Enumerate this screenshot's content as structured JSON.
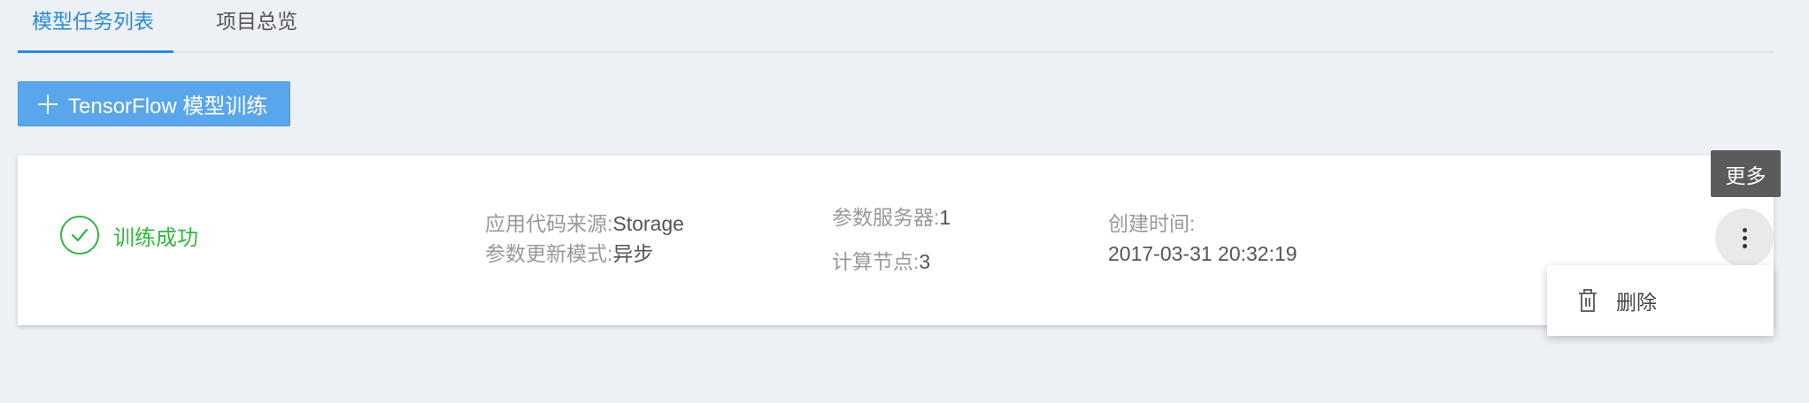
{
  "tabs": [
    {
      "label": "模型任务列表",
      "active": true
    },
    {
      "label": "项目总览",
      "active": false
    }
  ],
  "create_button": {
    "label": "TensorFlow 模型训练",
    "icon": "plus-icon"
  },
  "task": {
    "status": {
      "text": "训练成功",
      "icon": "check-circle-icon",
      "color": "#2db83d"
    },
    "code_source": {
      "label": "应用代码来源:",
      "value": "Storage"
    },
    "update_mode": {
      "label": "参数更新模式:",
      "value": "异步"
    },
    "param_servers": {
      "label": "参数服务器:",
      "value": "1"
    },
    "compute_nodes": {
      "label": "计算节点:",
      "value": "3"
    },
    "created": {
      "label": "创建时间:",
      "value": "2017-03-31 20:32:19"
    }
  },
  "more": {
    "tooltip": "更多",
    "icon": "more-vertical-icon"
  },
  "menu": {
    "delete_label": "删除",
    "delete_icon": "trash-icon"
  },
  "colors": {
    "accent": "#2a8be0",
    "button": "#5aa6ec",
    "success": "#2db83d",
    "background": "#edf1f6"
  }
}
